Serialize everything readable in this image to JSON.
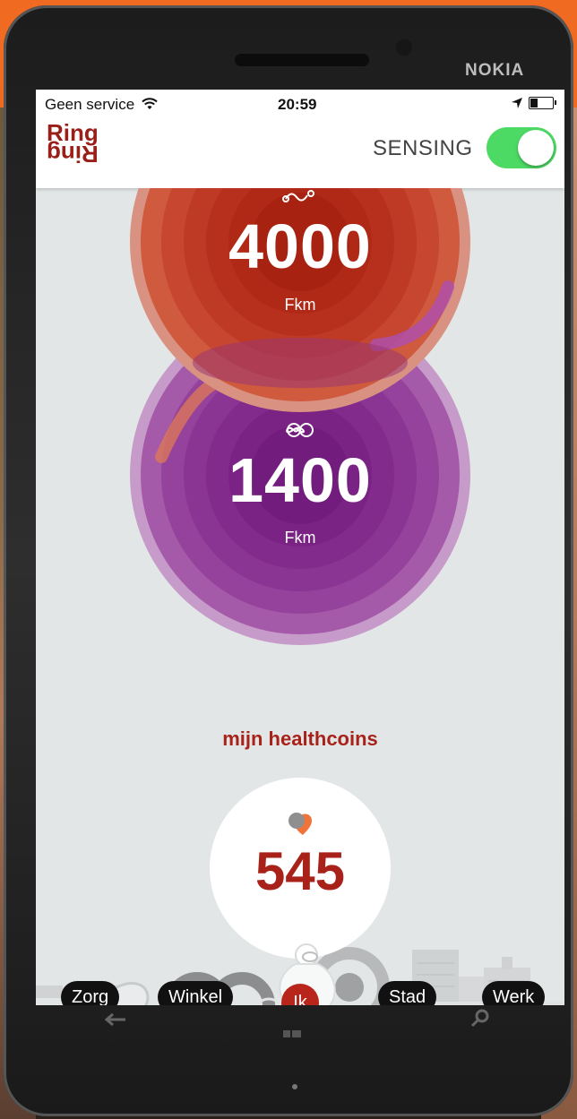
{
  "device": {
    "brand": "NOKIA"
  },
  "statusbar": {
    "carrier": "Geen service",
    "time": "20:59"
  },
  "appbar": {
    "logo_top": "Ring",
    "logo_bottom": "Ring",
    "sensing_label": "SENSING",
    "sensing_on": true
  },
  "rings": {
    "top": {
      "value": "4000",
      "unit": "Fkm",
      "icon": "route-icon",
      "color": "#c0341f"
    },
    "bottom": {
      "value": "1400",
      "unit": "Fkm",
      "icon": "infinity-icon",
      "color": "#82278a"
    }
  },
  "healthcoins": {
    "title": "mijn healthcoins",
    "value": "545",
    "icon": "coin-heart-icon"
  },
  "nav": {
    "zorg": "Zorg",
    "winkel": "Winkel",
    "ik": "Ik",
    "stad": "Stad",
    "werk": "Werk"
  },
  "colors": {
    "accent": "#a8221a",
    "toggle_on": "#4cd964"
  }
}
